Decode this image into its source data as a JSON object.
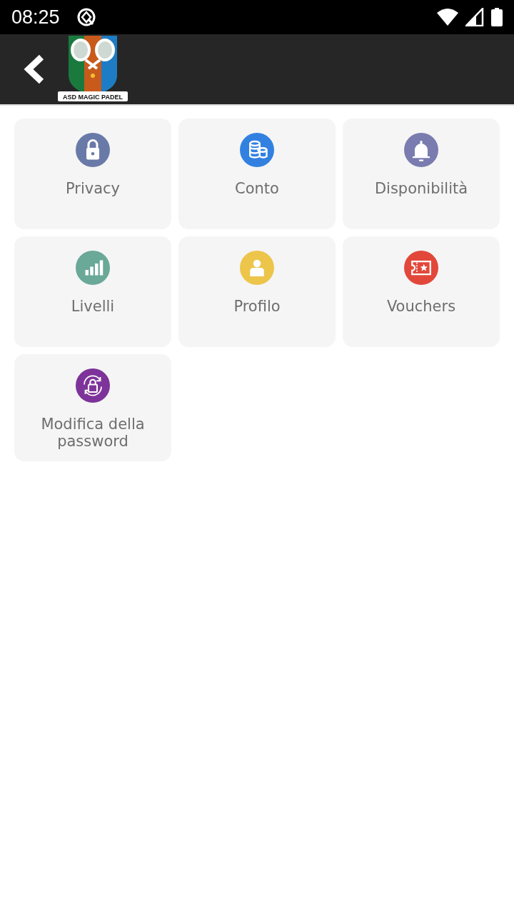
{
  "status_bar": {
    "time": "08:25"
  },
  "app_bar": {
    "logo_text": "ASD MAGIC PADEL"
  },
  "tiles": [
    {
      "label": "Privacy",
      "kind": "lock",
      "color": "#6a7aa8"
    },
    {
      "label": "Conto",
      "kind": "coins",
      "color": "#3281e0"
    },
    {
      "label": "Disponibilità",
      "kind": "bell",
      "color": "#7a7cb0"
    },
    {
      "label": "Livelli",
      "kind": "bars",
      "color": "#6aa898"
    },
    {
      "label": "Profilo",
      "kind": "person",
      "color": "#ecc54a"
    },
    {
      "label": "Vouchers",
      "kind": "ticket",
      "color": "#e2483a"
    },
    {
      "label": "Modifica della password",
      "kind": "reset-lock",
      "color": "#7d3399"
    }
  ]
}
